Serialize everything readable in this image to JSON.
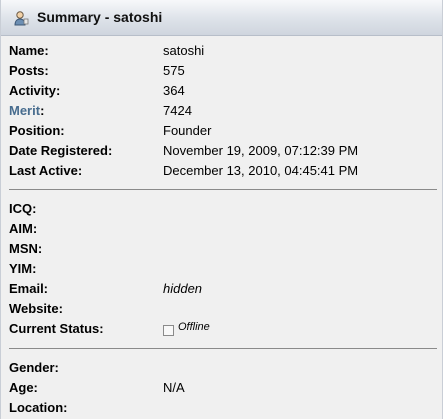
{
  "header": {
    "title": "Summary - satoshi",
    "icon": "user-icon"
  },
  "summary": [
    {
      "label": "Name:",
      "value": "satoshi"
    },
    {
      "label": "Posts:",
      "value": "575"
    },
    {
      "label": "Activity:",
      "value": "364"
    },
    {
      "label": "Merit",
      "colon": ":",
      "value": "7424",
      "label_color": "#476c8e"
    },
    {
      "label": "Position:",
      "value": "Founder"
    },
    {
      "label": "Date Registered:",
      "value": "November 19, 2009, 07:12:39 PM"
    },
    {
      "label": "Last Active:",
      "value": "December 13, 2010, 04:45:41 PM"
    }
  ],
  "contact": [
    {
      "label": "ICQ:",
      "value": ""
    },
    {
      "label": "AIM:",
      "value": ""
    },
    {
      "label": "MSN:",
      "value": ""
    },
    {
      "label": "YIM:",
      "value": ""
    },
    {
      "label": "Email:",
      "value": "hidden"
    },
    {
      "label": "Website:",
      "value": ""
    },
    {
      "label": "Current Status:",
      "status": "Offline",
      "status_icon": "offline-status-icon"
    }
  ],
  "personal": [
    {
      "label": "Gender:",
      "value": ""
    },
    {
      "label": "Age:",
      "value": "N/A"
    },
    {
      "label": "Location:",
      "value": ""
    }
  ]
}
